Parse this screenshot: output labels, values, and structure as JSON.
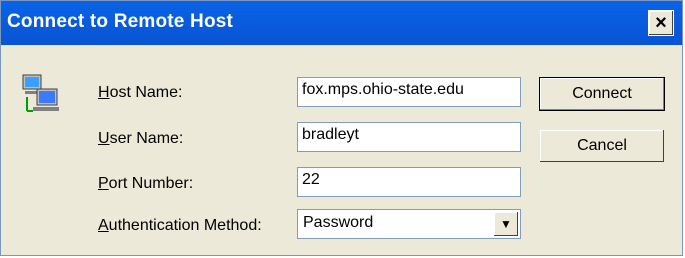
{
  "title": "Connect to Remote Host",
  "close_symbol": "×",
  "fields": [
    {
      "label_mnemonic": "H",
      "label_rest": "ost Name:",
      "value": "fox.mps.ohio-state.edu"
    },
    {
      "label_mnemonic": "U",
      "label_rest": "ser Name:",
      "value": "bradleyt"
    },
    {
      "label_mnemonic": "P",
      "label_rest": "ort Number:",
      "value": "22"
    }
  ],
  "auth": {
    "label_mnemonic": "A",
    "label_rest": "uthentication Method:",
    "value": "Password",
    "arrow_symbol": "▼"
  },
  "buttons": {
    "connect": "Connect",
    "cancel": "Cancel"
  },
  "icon": {
    "name": "network-computers-icon"
  }
}
